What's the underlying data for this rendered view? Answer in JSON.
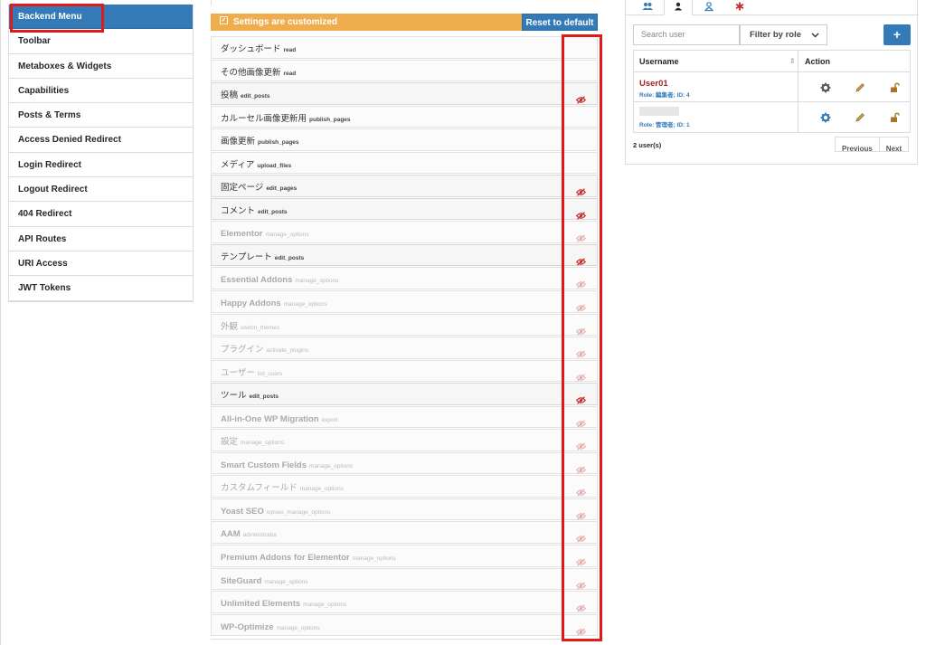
{
  "sidebar": {
    "items": [
      {
        "label": "Backend Menu",
        "active": true
      },
      {
        "label": "Toolbar"
      },
      {
        "label": "Metaboxes & Widgets"
      },
      {
        "label": "Capabilities"
      },
      {
        "label": "Posts & Terms"
      },
      {
        "label": "Access Denied Redirect"
      },
      {
        "label": "Login Redirect"
      },
      {
        "label": "Logout Redirect"
      },
      {
        "label": "404 Redirect"
      },
      {
        "label": "API Routes"
      },
      {
        "label": "URI Access"
      },
      {
        "label": "JWT Tokens"
      }
    ]
  },
  "main": {
    "banner_text": "Settings are customized",
    "reset_label": "Reset to default",
    "menu_items": [
      {
        "name": "ダッシュボード",
        "cap": "read",
        "eye": "none",
        "dim": false
      },
      {
        "name": "その他画像更新",
        "cap": "read",
        "eye": "none",
        "dim": false
      },
      {
        "name": "投稿",
        "cap": "edit_posts",
        "eye": "on",
        "dim": false
      },
      {
        "name": "カルーセル画像更新用",
        "cap": "publish_pages",
        "eye": "none",
        "dim": false
      },
      {
        "name": "画像更新",
        "cap": "publish_pages",
        "eye": "none",
        "dim": false
      },
      {
        "name": "メディア",
        "cap": "upload_files",
        "eye": "none",
        "dim": false
      },
      {
        "name": "固定ページ",
        "cap": "edit_pages",
        "eye": "on",
        "dim": false
      },
      {
        "name": "コメント",
        "cap": "edit_posts",
        "eye": "on",
        "dim": false
      },
      {
        "name": "Elementor",
        "cap": "manage_options",
        "eye": "faded",
        "dim": true
      },
      {
        "name": "テンプレート",
        "cap": "edit_posts",
        "eye": "on",
        "dim": false
      },
      {
        "name": "Essential Addons",
        "cap": "manage_options",
        "eye": "faded",
        "dim": true
      },
      {
        "name": "Happy Addons",
        "cap": "manage_options",
        "eye": "faded",
        "dim": true
      },
      {
        "name": "外観",
        "cap": "switch_themes",
        "eye": "faded",
        "dim": true
      },
      {
        "name": "プラグイン",
        "cap": "activate_plugins",
        "eye": "faded",
        "dim": true
      },
      {
        "name": "ユーザー",
        "cap": "list_users",
        "eye": "faded",
        "dim": true
      },
      {
        "name": "ツール",
        "cap": "edit_posts",
        "eye": "on",
        "dim": false
      },
      {
        "name": "All-in-One WP Migration",
        "cap": "export",
        "eye": "faded",
        "dim": true
      },
      {
        "name": "設定",
        "cap": "manage_options",
        "eye": "faded",
        "dim": true
      },
      {
        "name": "Smart Custom Fields",
        "cap": "manage_options",
        "eye": "faded",
        "dim": true
      },
      {
        "name": "カスタムフィールド",
        "cap": "manage_options",
        "eye": "faded",
        "dim": true
      },
      {
        "name": "Yoast SEO",
        "cap": "wpseo_manage_options",
        "eye": "faded",
        "dim": true
      },
      {
        "name": "AAM",
        "cap": "administrator",
        "eye": "faded",
        "dim": true
      },
      {
        "name": "Premium Addons for Elementor",
        "cap": "manage_options",
        "eye": "faded",
        "dim": true
      },
      {
        "name": "SiteGuard",
        "cap": "manage_options",
        "eye": "faded",
        "dim": true
      },
      {
        "name": "Unlimited Elements",
        "cap": "manage_options",
        "eye": "faded",
        "dim": true
      },
      {
        "name": "WP-Optimize",
        "cap": "manage_options",
        "eye": "faded",
        "dim": true
      }
    ]
  },
  "users_panel": {
    "tab_icons": [
      "users-icon",
      "user-icon",
      "visitor-icon",
      "default-icon"
    ],
    "search_placeholder": "Search user",
    "filter_label": "Filter by role",
    "add_label": "+",
    "col_username": "Username",
    "col_action": "Action",
    "users": [
      {
        "name": "User01",
        "role_line": "Role: 編集者; ID: 4",
        "name_visible": true
      },
      {
        "name": "",
        "role_line": "Role: 管理者; ID: 1",
        "name_visible": false
      }
    ],
    "count_text": "2 user(s)",
    "prev_label": "Previous",
    "next_label": "Next"
  },
  "colors": {
    "accent": "#337ab7",
    "warning": "#f0ad4e",
    "highlight": "#e01919",
    "eye_red": "#c9302c",
    "username_red": "#a02525"
  }
}
